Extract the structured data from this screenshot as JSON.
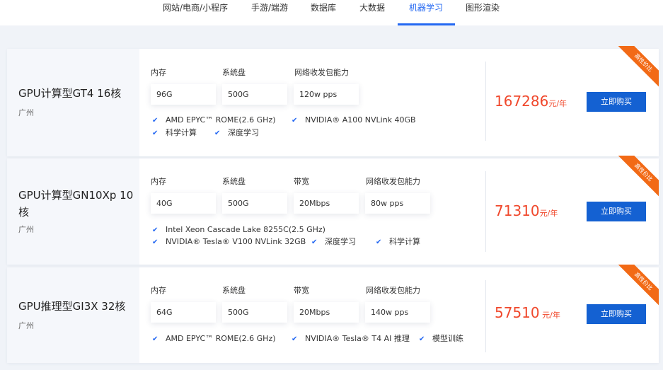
{
  "nav": {
    "tabs": [
      {
        "label": "网站/电商/小程序"
      },
      {
        "label": "手游/端游"
      },
      {
        "label": "数据库"
      },
      {
        "label": "大数据"
      },
      {
        "label": "机器学习"
      },
      {
        "label": "图形渲染"
      }
    ],
    "active_tab": "机器学习"
  },
  "colors": {
    "accent": "#2468f2",
    "price": "#f0482c",
    "button": "#1461d2",
    "ribbon": "#f26a16"
  },
  "products": [
    {
      "name": "GPU计算型GT4 16核",
      "region": "广州",
      "fields": [
        {
          "label": "内存",
          "value": "96G"
        },
        {
          "label": "系统盘",
          "value": "500G"
        },
        {
          "label": "网络收发包能力",
          "value": "120w pps"
        }
      ],
      "features": [
        "AMD EPYC™ ROME(2.6 GHz)",
        "NVIDIA® A100 NVLink 40GB",
        "科学计算",
        "深度学习"
      ],
      "price": "167286",
      "price_unit": "元/年",
      "buy_label": "立即购买",
      "ribbon": "高性价比"
    },
    {
      "name": "GPU计算型GN10Xp 10核",
      "region": "广州",
      "fields": [
        {
          "label": "内存",
          "value": "40G"
        },
        {
          "label": "系统盘",
          "value": "500G"
        },
        {
          "label": "带宽",
          "value": "20Mbps"
        },
        {
          "label": "网络收发包能力",
          "value": "80w pps"
        }
      ],
      "features": [
        "Intel Xeon Cascade Lake 8255C(2.5 GHz)",
        "NVIDIA® Tesla® V100 NVLink 32GB",
        "深度学习",
        "科学计算"
      ],
      "price": "71310",
      "price_unit": "元/年",
      "buy_label": "立即购买",
      "ribbon": "高性价比"
    },
    {
      "name": "GPU推理型GI3X 32核",
      "region": "广州",
      "fields": [
        {
          "label": "内存",
          "value": "64G"
        },
        {
          "label": "系统盘",
          "value": "500G"
        },
        {
          "label": "带宽",
          "value": "20Mbps"
        },
        {
          "label": "网络收发包能力",
          "value": "140w pps"
        }
      ],
      "features": [
        "AMD EPYC™ ROME(2.6 GHz)",
        "NVIDIA® Tesla® T4 AI 推理",
        "模型训练"
      ],
      "price": "57510",
      "price_unit": " 元/年",
      "buy_label": "立即购买",
      "ribbon": "高性价比"
    }
  ]
}
